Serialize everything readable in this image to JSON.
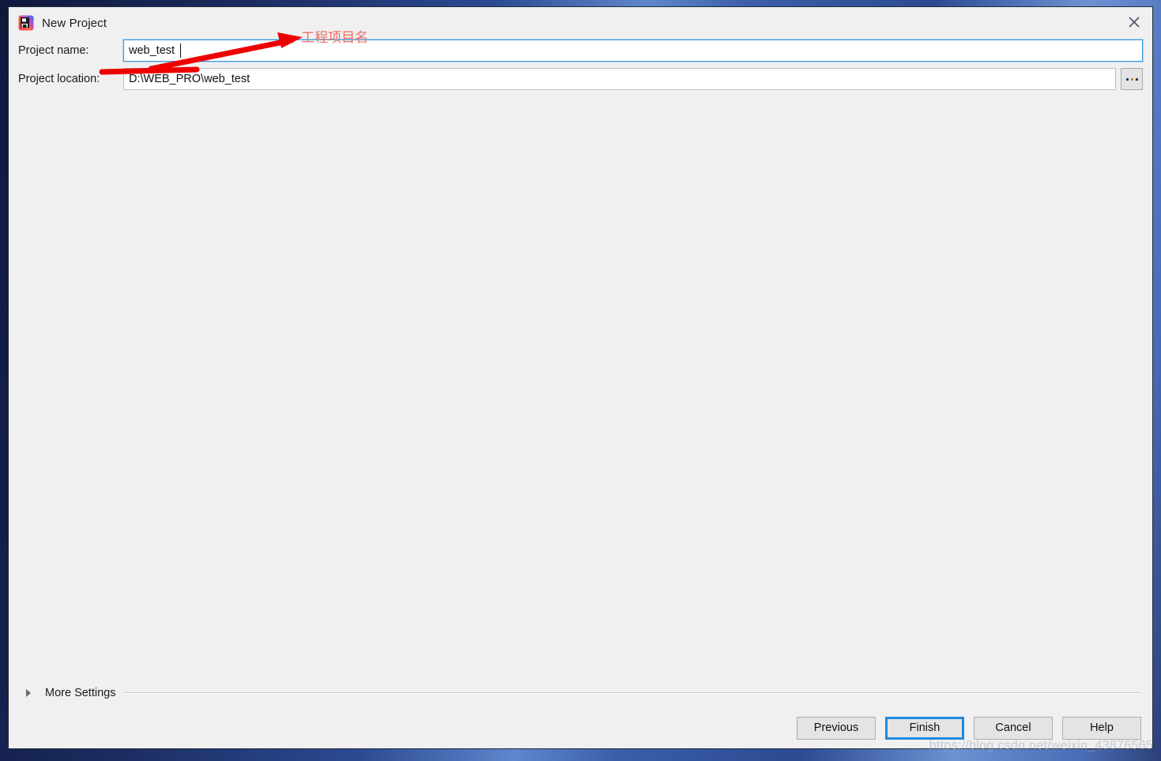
{
  "window": {
    "title": "New Project",
    "icon": "intellij-idea-logo-icon",
    "close_label": "close-icon"
  },
  "form": {
    "project_name": {
      "label": "Project name:",
      "value": "web_test",
      "placeholder": ""
    },
    "project_location": {
      "label": "Project location:",
      "value": "D:\\WEB_PRO\\web_test",
      "placeholder": "",
      "browse_label": "..."
    }
  },
  "annotation": {
    "chinese_note": "工程项目名",
    "color": "#ef6b62"
  },
  "more_settings": {
    "label": "More Settings",
    "expanded": false
  },
  "buttons": {
    "previous": "Previous",
    "finish": "Finish",
    "cancel": "Cancel",
    "help": "Help",
    "default_button": "Finish"
  },
  "watermark": {
    "text": "https://blog.csdn.net/weixin_43876565"
  },
  "colors": {
    "dialog_bg": "#f0f0f0",
    "focus_blue": "#3d9ae2",
    "default_button_blue": "#1f8ae0",
    "annotation_red": "#ef0000"
  }
}
